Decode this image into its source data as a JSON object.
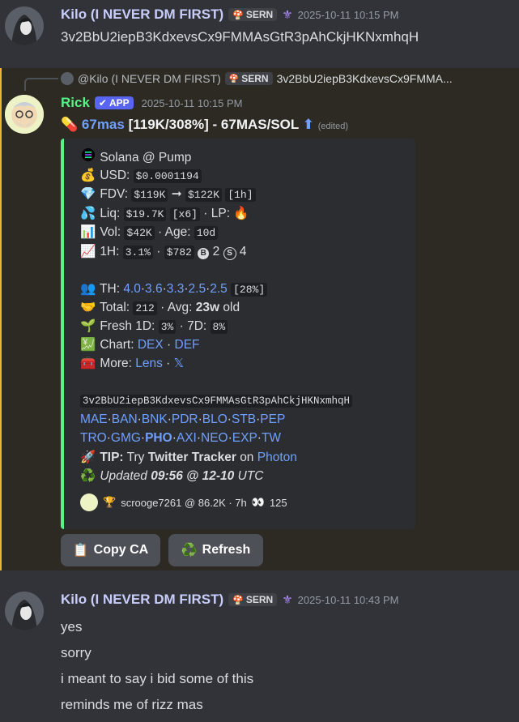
{
  "msg1": {
    "author": "Kilo (I NEVER DM FIRST)",
    "tag": "SERN",
    "timestamp": "2025-10-11 10:15 PM",
    "text": "3v2BbU2iepB3KdxevsCx9FMMAsGtR3pAhCkjHKNxmhqH"
  },
  "reply": {
    "author": "@Kilo (I NEVER DM FIRST)",
    "tag": "SERN",
    "text": "3v2BbU2iepB3KdxevsCx9FMMA..."
  },
  "msg2": {
    "author": "Rick",
    "app_tag": "APP",
    "timestamp": "2025-10-11 10:15 PM",
    "headline_link": "67mas",
    "headline_rest": "[119K/308%] - 67MAS/SOL",
    "edited": "(edited)",
    "embed": {
      "chain": "Solana @ Pump",
      "usd_label": "USD:",
      "usd": "$0.0001194",
      "fdv_label": "FDV:",
      "fdv_from": "$119K",
      "arrow": "➞",
      "fdv_to": "$122K",
      "fdv_period": "[1h]",
      "liq_label": "Liq:",
      "liq": "$19.7K",
      "liq_mult": "[x6]",
      "lp_label": "· LP:",
      "vol_label": "Vol:",
      "vol": "$42K",
      "age_label": "· Age:",
      "age": "10d",
      "h1_label": "1H:",
      "h1_pct": "3.1%",
      "h1_usd": "$782",
      "h1_b_count": "2",
      "h1_s_count": "4",
      "th_label": "TH:",
      "th_values": [
        "4.0",
        "3.6",
        "3.3",
        "2.5",
        "2.5"
      ],
      "th_total": "[28%]",
      "total_label": "Total:",
      "total": "212",
      "avg_label": "· Avg:",
      "avg": "23w",
      "avg_suffix": "old",
      "fresh_label": "Fresh 1D:",
      "fresh_1d": "3%",
      "fresh_7d_label": "· 7D:",
      "fresh_7d": "8%",
      "chart_label": "Chart:",
      "chart_links": [
        "DEX",
        "DEF"
      ],
      "more_label": "More:",
      "more_links": [
        "Lens",
        "𝕏"
      ],
      "ca": "3v2BbU2iepB3KdxevsCx9FMMAsGtR3pAhCkjHKNxmhqH",
      "bots_row1": [
        "MAE",
        "BAN",
        "BNK",
        "PDR",
        "BLO",
        "STB",
        "PEP"
      ],
      "bots_row2": [
        "TRO",
        "GMG",
        "PHO",
        "AXI",
        "NEO",
        "EXP",
        "TW"
      ],
      "tip_label": "TIP:",
      "tip_pre": "Try",
      "tip_bold": "Twitter Tracker",
      "tip_on": "on",
      "tip_link": "Photon",
      "updated_pre": "Updated",
      "updated_time": "09:56 @ 12-10",
      "updated_tz": "UTC",
      "footer": "scrooge7261 @ 86.2K · 7h",
      "footer_count": "125"
    },
    "buttons": {
      "copy": "Copy CA",
      "refresh": "Refresh"
    }
  },
  "msg3": {
    "author": "Kilo (I NEVER DM FIRST)",
    "tag": "SERN",
    "timestamp": "2025-10-11 10:43 PM",
    "lines": [
      "yes",
      "sorry",
      "i meant to say i bid some of this",
      "reminds me of rizz mas"
    ]
  },
  "colors": {
    "background": "#313338",
    "highlight": "#2c2a22",
    "embed_bar": "#57f287",
    "link": "#00a8fc",
    "rick_name": "#57f287",
    "kilo_name": "#c9cdfb"
  }
}
